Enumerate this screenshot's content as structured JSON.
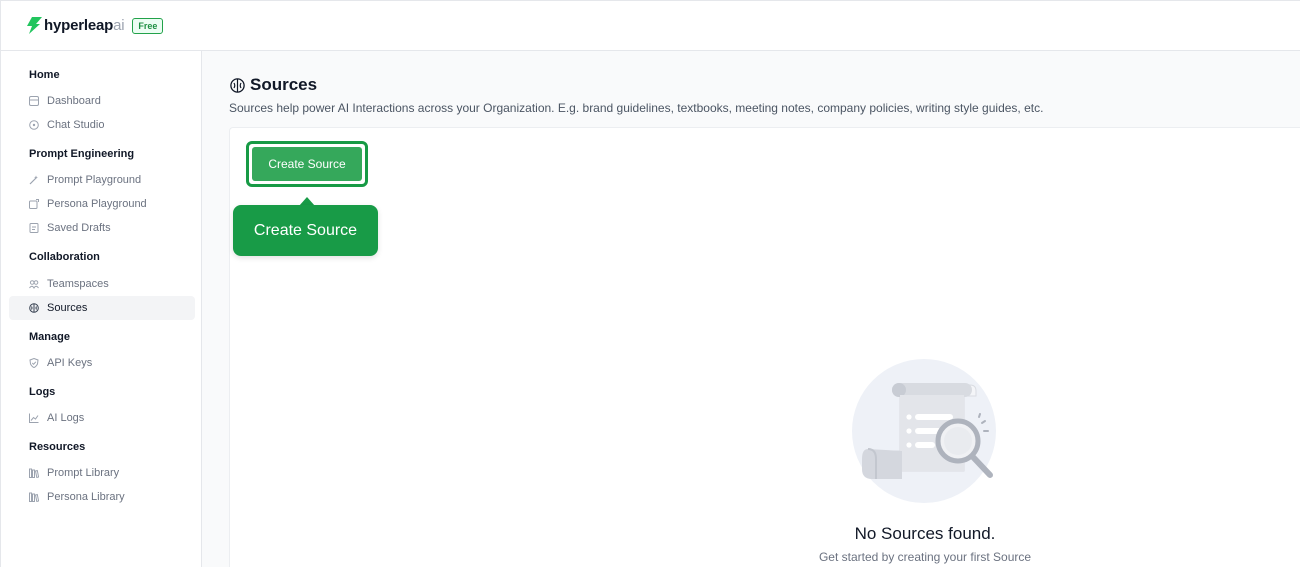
{
  "brand": {
    "name": "hyperleap",
    "suffix": "ai",
    "plan_badge": "Free",
    "accent": "#22a24a"
  },
  "sidebar": {
    "sections": [
      {
        "title": "Home",
        "items": [
          {
            "label": "Dashboard",
            "icon": "dashboard-icon"
          },
          {
            "label": "Chat Studio",
            "icon": "chat-icon"
          }
        ]
      },
      {
        "title": "Prompt Engineering",
        "items": [
          {
            "label": "Prompt Playground",
            "icon": "wand-icon"
          },
          {
            "label": "Persona Playground",
            "icon": "persona-icon"
          },
          {
            "label": "Saved Drafts",
            "icon": "drafts-icon"
          }
        ]
      },
      {
        "title": "Collaboration",
        "items": [
          {
            "label": "Teamspaces",
            "icon": "team-icon"
          },
          {
            "label": "Sources",
            "icon": "brain-icon",
            "active": true
          }
        ]
      },
      {
        "title": "Manage",
        "items": [
          {
            "label": "API Keys",
            "icon": "shield-icon"
          }
        ]
      },
      {
        "title": "Logs",
        "items": [
          {
            "label": "AI Logs",
            "icon": "chart-icon"
          }
        ]
      },
      {
        "title": "Resources",
        "items": [
          {
            "label": "Prompt Library",
            "icon": "library-icon"
          },
          {
            "label": "Persona Library",
            "icon": "library-icon"
          }
        ]
      }
    ]
  },
  "main": {
    "title": "Sources",
    "description": "Sources help power AI Interactions across your Organization. E.g. brand guidelines, textbooks, meeting notes, company policies, writing style guides, etc.",
    "create_button_label": "Create Source",
    "tooltip_text": "Create Source",
    "empty_state": {
      "title": "No Sources found.",
      "subtitle": "Get started by creating your first Source"
    }
  }
}
